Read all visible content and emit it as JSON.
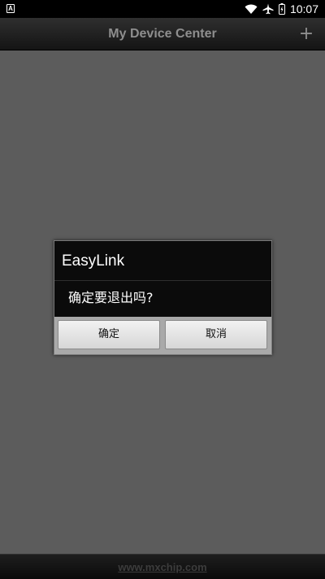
{
  "status_bar": {
    "app_badge": "A",
    "time": "10:07",
    "icons": [
      "wifi-icon",
      "airplane-icon",
      "battery-icon"
    ]
  },
  "title_bar": {
    "title": "My Device Center",
    "add_label": "+"
  },
  "dialog": {
    "title": "EasyLink",
    "message": "确定要退出吗?",
    "ok_label": "确定",
    "cancel_label": "取消"
  },
  "footer": {
    "link_text": "www.mxchip.com"
  },
  "colors": {
    "content_background": "#5c5c5c",
    "dialog_background": "#0b0b0b",
    "button_bar": "#a9a9a9",
    "title_text": "#8e8e8e"
  }
}
